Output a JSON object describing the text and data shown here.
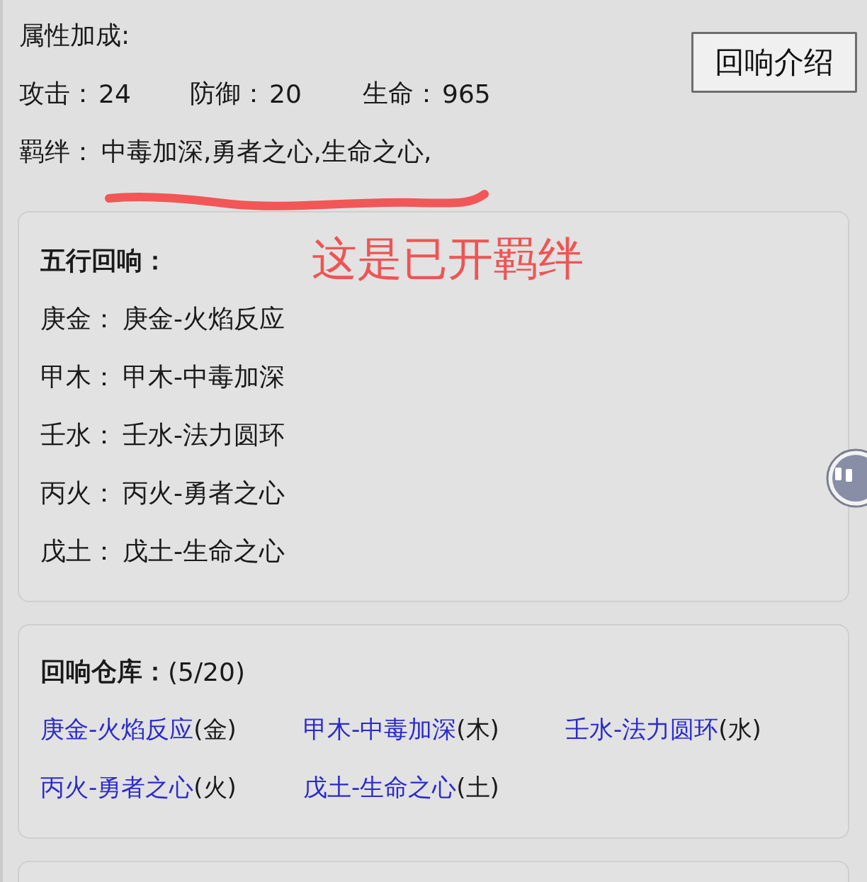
{
  "bonus": {
    "title": "属性加成:",
    "stats": [
      {
        "label": "攻击：",
        "value": "24"
      },
      {
        "label": "防御：",
        "value": "20"
      },
      {
        "label": "生命：",
        "value": "965"
      }
    ],
    "bonds": {
      "label": "羁绊：",
      "value": "中毒加深,勇者之心,生命之心,"
    }
  },
  "intro_button": {
    "label": "回响介绍"
  },
  "annotation": {
    "text": "这是已开羁绊"
  },
  "five_elements": {
    "title": "五行回响：",
    "rows": [
      {
        "label": "庚金：",
        "value": "庚金-火焰反应"
      },
      {
        "label": "甲木：",
        "value": "甲木-中毒加深"
      },
      {
        "label": "壬水：",
        "value": "壬水-法力圆环"
      },
      {
        "label": "丙火：",
        "value": "丙火-勇者之心"
      },
      {
        "label": "戊土：",
        "value": "戊土-生命之心"
      }
    ]
  },
  "warehouse": {
    "title": "回响仓库：",
    "count": "(5/20)",
    "items": [
      {
        "name": "庚金-火焰反应",
        "element": "(金)"
      },
      {
        "name": "甲木-中毒加深",
        "element": "(木)"
      },
      {
        "name": "壬水-法力圆环",
        "element": "(水)"
      },
      {
        "name": "丙火-勇者之心",
        "element": "(火)"
      },
      {
        "name": "戊土-生命之心",
        "element": "(土)"
      }
    ]
  }
}
